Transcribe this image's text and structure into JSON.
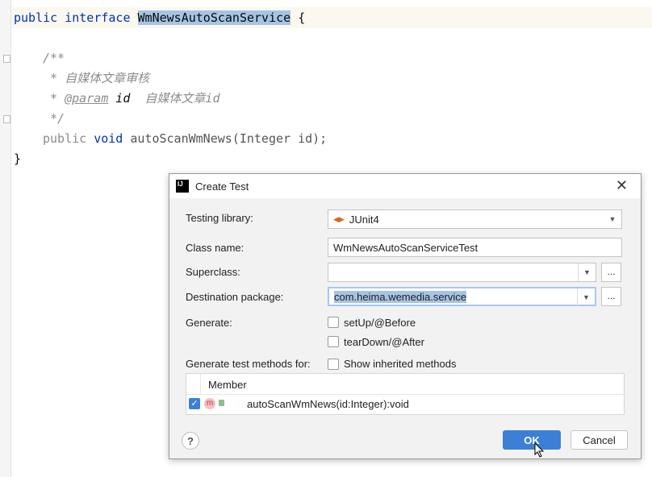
{
  "editor": {
    "line1_kw": "public interface ",
    "line1_name": "WmNewsAutoScanService",
    "line1_end": " {",
    "doc_open": "/**",
    "doc_line1": " * 自媒体文章审核",
    "doc_star": " * ",
    "doc_tag": "@param",
    "doc_param": " id",
    "doc_desc": "  自媒体文章id",
    "doc_close": " */",
    "method_kw1": "public ",
    "method_kw2": "void ",
    "method_sig": "autoScanWmNews(Integer id);",
    "closing": "}"
  },
  "dialog": {
    "title": "Create Test",
    "close_icon": "close-icon",
    "testing_library_label": "Testing library:",
    "testing_library_value": "JUnit4",
    "class_name_label": "Class name:",
    "class_name_value": "WmNewsAutoScanServiceTest",
    "superclass_label": "Superclass:",
    "superclass_value": "",
    "destination_label": "Destination package:",
    "destination_value": "com.heima.wemedia.service",
    "browse": "...",
    "generate_label": "Generate:",
    "setup": "setUp/@Before",
    "setup_checked": false,
    "teardown": "tearDown/@After",
    "teardown_checked": false,
    "methods_label": "Generate test methods for:",
    "show_inherited": "Show inherited methods",
    "show_inherited_checked": false,
    "table_header": "Member",
    "rows": [
      {
        "checked": true,
        "icon": "m",
        "member": "autoScanWmNews(id:Integer):void"
      }
    ],
    "help": "?",
    "ok": "OK",
    "cancel": "Cancel",
    "accent": "#3d7fd6"
  }
}
